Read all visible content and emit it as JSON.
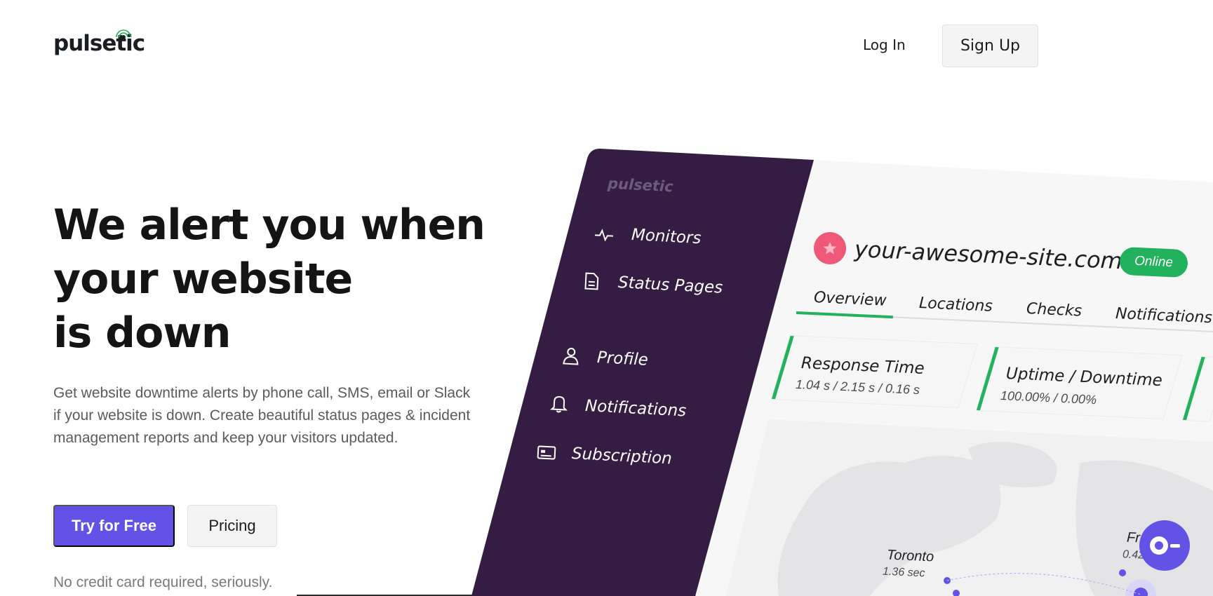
{
  "header": {
    "logo": "pulsetic",
    "login_label": "Log In",
    "signup_label": "Sign Up"
  },
  "hero": {
    "title_lines": [
      "We alert you when",
      "your website",
      "is down"
    ],
    "description": "Get website downtime alerts by phone call, SMS, email or Slack if your website is down. Create beautiful status pages & incident management reports and keep your visitors updated.",
    "cta_primary": "Try for Free",
    "cta_secondary": "Pricing",
    "note": "No credit card required, seriously."
  },
  "dashboard": {
    "logo": "pulsetic",
    "sidebar": {
      "items": [
        {
          "label": "Monitors",
          "icon": "pulse-icon"
        },
        {
          "label": "Status Pages",
          "icon": "document-icon"
        },
        {
          "label": "Profile",
          "icon": "user-icon"
        },
        {
          "label": "Notifications",
          "icon": "bell-icon"
        },
        {
          "label": "Subscription",
          "icon": "card-icon"
        }
      ]
    },
    "site": {
      "name": "your-awesome-site.com",
      "status": "Online"
    },
    "tabs": [
      "Overview",
      "Locations",
      "Checks",
      "Notifications"
    ],
    "cards": [
      {
        "title": "Response Time",
        "value": "1.04 s / 2.15 s / 0.16 s"
      },
      {
        "title": "Uptime / Downtime",
        "value": "100.00% / 0.00%"
      }
    ],
    "map": {
      "cities": [
        {
          "name": "Toronto",
          "value": "1.36 sec"
        },
        {
          "name": "Fr",
          "value": "0.42"
        }
      ]
    }
  },
  "colors": {
    "accent": "#6252e6",
    "sidebar": "#351c42",
    "success": "#22b15d",
    "badge": "#f0587a"
  }
}
